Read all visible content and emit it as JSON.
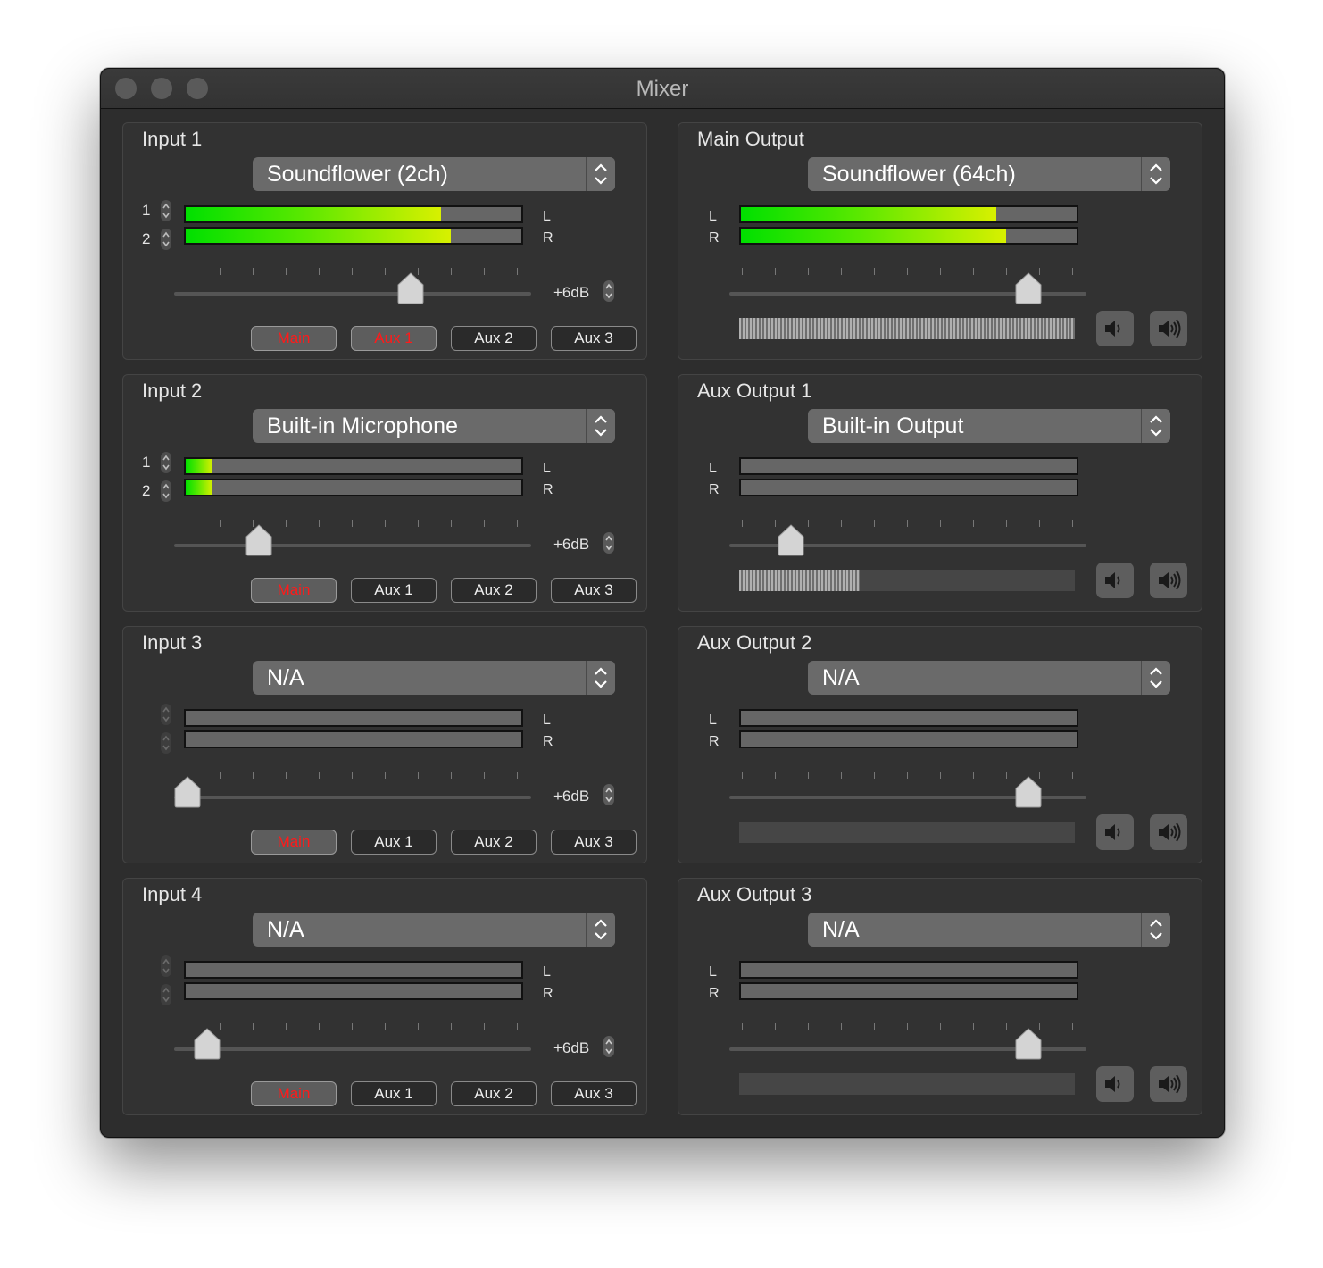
{
  "window": {
    "title": "Mixer"
  },
  "inputs": [
    {
      "title": "Input 1",
      "device": "Soundflower (2ch)",
      "channels": [
        "1",
        "2"
      ],
      "left_label": "L",
      "right_label": "R",
      "level_left": 0.76,
      "level_right": 0.79,
      "gain_fraction": 0.78,
      "gain_label": "+6dB",
      "routes": [
        {
          "label": "Main",
          "active": true
        },
        {
          "label": "Aux 1",
          "active": true
        },
        {
          "label": "Aux 2",
          "active": false
        },
        {
          "label": "Aux 3",
          "active": false
        }
      ]
    },
    {
      "title": "Input 2",
      "device": "Built-in Microphone",
      "channels": [
        "1",
        "2"
      ],
      "left_label": "L",
      "right_label": "R",
      "level_left": 0.08,
      "level_right": 0.08,
      "gain_fraction": 0.25,
      "gain_label": "+6dB",
      "routes": [
        {
          "label": "Main",
          "active": true
        },
        {
          "label": "Aux 1",
          "active": false
        },
        {
          "label": "Aux 2",
          "active": false
        },
        {
          "label": "Aux 3",
          "active": false
        }
      ]
    },
    {
      "title": "Input 3",
      "device": "N/A",
      "channels": [
        "",
        ""
      ],
      "left_label": "L",
      "right_label": "R",
      "level_left": 0,
      "level_right": 0,
      "gain_fraction": 0.0,
      "gain_label": "+6dB",
      "routes": [
        {
          "label": "Main",
          "active": true
        },
        {
          "label": "Aux 1",
          "active": false
        },
        {
          "label": "Aux 2",
          "active": false
        },
        {
          "label": "Aux 3",
          "active": false
        }
      ]
    },
    {
      "title": "Input 4",
      "device": "N/A",
      "channels": [
        "",
        ""
      ],
      "left_label": "L",
      "right_label": "R",
      "level_left": 0,
      "level_right": 0,
      "gain_fraction": 0.07,
      "gain_label": "+6dB",
      "routes": [
        {
          "label": "Main",
          "active": true
        },
        {
          "label": "Aux 1",
          "active": false
        },
        {
          "label": "Aux 2",
          "active": false
        },
        {
          "label": "Aux 3",
          "active": false
        }
      ]
    }
  ],
  "outputs": [
    {
      "title": "Main Output",
      "device": "Soundflower (64ch)",
      "left_label": "L",
      "right_label": "R",
      "level_left": 0.76,
      "level_right": 0.79,
      "gain_fraction": 1.0,
      "volume_fraction": 1.0
    },
    {
      "title": "Aux Output 1",
      "device": "Built-in Output",
      "left_label": "L",
      "right_label": "R",
      "level_left": 0,
      "level_right": 0,
      "gain_fraction": 0.17,
      "volume_fraction": 0.36
    },
    {
      "title": "Aux Output 2",
      "device": "N/A",
      "left_label": "L",
      "right_label": "R",
      "level_left": 0,
      "level_right": 0,
      "gain_fraction": 1.0,
      "volume_fraction": 0
    },
    {
      "title": "Aux Output 3",
      "device": "N/A",
      "left_label": "L",
      "right_label": "R",
      "level_left": 0,
      "level_right": 0,
      "gain_fraction": 1.0,
      "volume_fraction": 0
    }
  ],
  "icons": {
    "quiet": "speaker-quiet-icon",
    "loud": "speaker-loud-icon",
    "stepper": "stepper-icon"
  },
  "colors": {
    "meter_start": "#00e000",
    "meter_end": "#d8f000",
    "route_active_text": "#ff1a1a"
  }
}
